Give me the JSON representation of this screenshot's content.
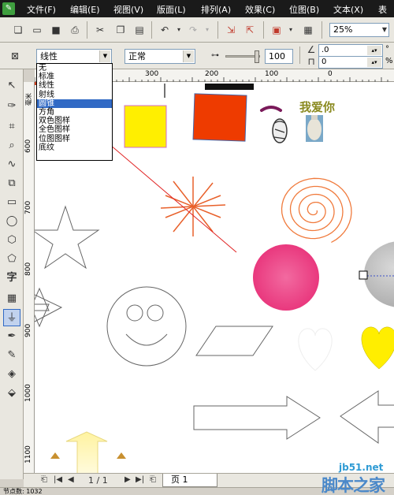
{
  "menu": {
    "items": [
      "文件(F)",
      "编辑(E)",
      "视图(V)",
      "版面(L)",
      "排列(A)",
      "效果(C)",
      "位图(B)",
      "文本(X)",
      "表"
    ]
  },
  "toolbar": {
    "zoom": "25%"
  },
  "property_bar": {
    "fill_type": "线性",
    "mode": "正常",
    "transparency_value": "100",
    "angle_value": ".0",
    "edge_value": "0",
    "angle_unit": "°",
    "edge_unit": "%"
  },
  "fill_dropdown": {
    "options": [
      "无",
      "标准",
      "线性",
      "射线",
      "圆锥",
      "方角",
      "双色图样",
      "全色图样",
      "位图图样",
      "底纹"
    ],
    "selected": "圆锥"
  },
  "ruler": {
    "h_labels": [
      "300",
      "200",
      "100",
      "0"
    ],
    "v_labels": [
      "600",
      "700",
      "800",
      "900",
      "1000",
      "1100"
    ],
    "v_unit": "毫米"
  },
  "canvas": {
    "text_label": "我爱你"
  },
  "pager": {
    "page_count": "1 / 1",
    "page_tab": "页 1"
  },
  "status": {
    "text": "节点数: 1032"
  },
  "watermark": {
    "site": "jb51.net",
    "name": "脚本之家"
  },
  "colors": {
    "menubar": "#1a1a1a",
    "selection": "#316ac5",
    "yellow_square": "#ffef00",
    "red_square": "#ee3b00",
    "spiral": "#f07a3c",
    "starburst": "#e8602a",
    "pink_circle": "#e8337a",
    "yellow_heart": "#ffee00"
  }
}
